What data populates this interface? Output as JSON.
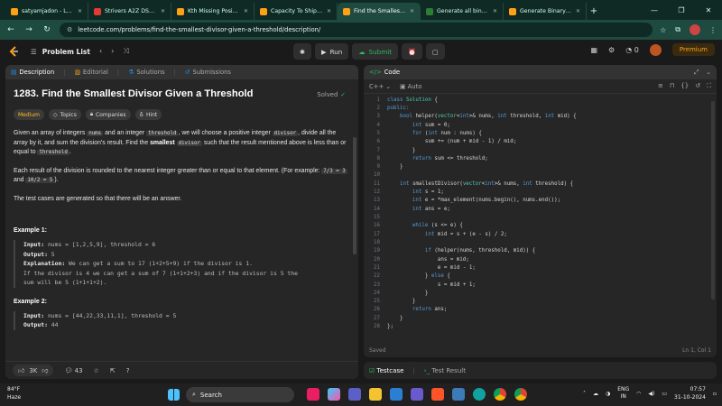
{
  "browser": {
    "tabs": [
      {
        "title": "satyamjadon - LeetC",
        "color": "#ffa116"
      },
      {
        "title": "Strivers A2Z DSA Co",
        "color": "#e53935"
      },
      {
        "title": "Kth Missing Positive",
        "color": "#ffa116"
      },
      {
        "title": "Capacity To Ship Pa",
        "color": "#ffa116"
      },
      {
        "title": "Find the Smallest Di",
        "color": "#ffa116"
      },
      {
        "title": "Generate all binary",
        "color": "#2e7d32"
      },
      {
        "title": "Generate Binary Strin",
        "color": "#ffa116"
      }
    ],
    "url": "leetcode.com/problems/find-the-smallest-divisor-given-a-threshold/description/"
  },
  "lcnav": {
    "problem_list": "Problem List",
    "run": "Run",
    "submit": "Submit",
    "streak": "0",
    "premium": "Premium"
  },
  "left_tabs": [
    "Description",
    "Editorial",
    "Solutions",
    "Submissions"
  ],
  "problem": {
    "title": "1283. Find the Smallest Divisor Given a Threshold",
    "solved": "Solved",
    "tags": [
      "Medium",
      "Topics",
      "Companies",
      "Hint"
    ],
    "p1_a": "Given an array of integers ",
    "p1_nums": "nums",
    "p1_b": " and an integer ",
    "p1_threshold": "threshold",
    "p1_c": ", we will choose a positive integer ",
    "p1_divisor": "divisor",
    "p1_d": ", divide all the array by it, and sum the division's result. Find the ",
    "p1_smallest": "smallest",
    "p1_e": " ",
    "p1_divisor2": "divisor",
    "p1_f": " such that the result mentioned above is less than or equal to ",
    "p1_threshold2": "threshold",
    "p1_g": ".",
    "p2_a": "Each result of the division is rounded to the nearest integer greater than or equal to that element. (For example: ",
    "p2_c1": "7/3 = 3",
    "p2_b": " and ",
    "p2_c2": "10/2 = 5",
    "p2_c": ").",
    "p3": "The test cases are generated so that there will be an answer.",
    "ex1_title": "Example 1:",
    "ex1_input_label": "Input:",
    "ex1_input": " nums = [1,2,5,9], threshold = 6",
    "ex1_output_label": "Output:",
    "ex1_output": " 5",
    "ex1_expl_label": "Explanation:",
    "ex1_expl": " We can get a sum to 17 (1+2+5+9) if the divisor is 1.",
    "ex1_expl2": "If the divisor is 4 we can get a sum of 7 (1+1+2+3) and if the divisor is 5 the",
    "ex1_expl3": "sum will be 5 (1+1+1+2).",
    "ex2_title": "Example 2:",
    "ex2_input_label": "Input:",
    "ex2_input": " nums = [44,22,33,11,1], threshold = 5",
    "ex2_output_label": "Output:",
    "ex2_output": " 44"
  },
  "footer": {
    "likes": "3K",
    "comments": "43"
  },
  "code_panel": {
    "title": "Code",
    "language": "C++",
    "mode": "Auto",
    "saved": "Saved",
    "cursor": "Ln 1, Col 1",
    "lines": [
      "class Solution {",
      "public:",
      "    bool helper(vector<int>& nums, int threshold, int mid) {",
      "        int sum = 0;",
      "        for (int num : nums) {",
      "            sum += (num + mid - 1) / mid;",
      "        }",
      "        return sum <= threshold;",
      "    }",
      "",
      "    int smallestDivisor(vector<int>& nums, int threshold) {",
      "        int s = 1;",
      "        int e = *max_element(nums.begin(), nums.end());",
      "        int ans = e;",
      "",
      "        while (s <= e) {",
      "            int mid = s + (e - s) / 2;",
      "",
      "            if (helper(nums, threshold, mid)) {",
      "                ans = mid;",
      "                e = mid - 1;",
      "            } else {",
      "                s = mid + 1;",
      "            }",
      "        }",
      "        return ans;",
      "    }",
      "};"
    ]
  },
  "bottom_tabs": [
    "Testcase",
    "Test Result"
  ],
  "taskbar": {
    "temp": "84°F",
    "weather": "Haze",
    "search": "Search",
    "lang1": "ENG",
    "lang2": "IN",
    "time": "07:57",
    "date": "31-10-2024"
  }
}
